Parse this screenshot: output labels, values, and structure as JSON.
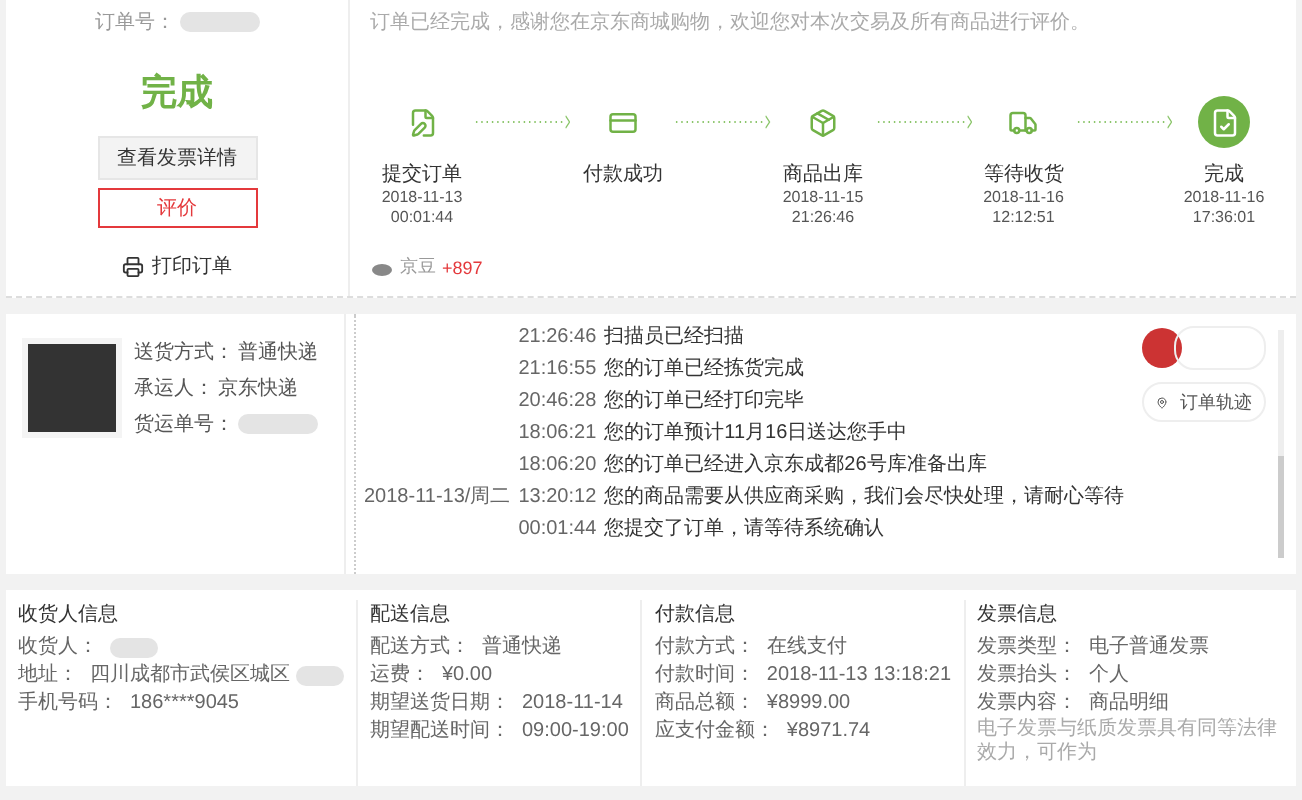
{
  "order": {
    "number_label": "订单号：",
    "status": "完成",
    "invoice_button": "查看发票详情",
    "review_button": "评价",
    "print_link": "打印订单"
  },
  "message": "订单已经完成，感谢您在京东商城购物，欢迎您对本次交易及所有商品进行评价。",
  "progress": [
    {
      "kind": "submit",
      "label": "提交订单",
      "date": "2018-11-13",
      "time": "00:01:44",
      "current": false
    },
    {
      "kind": "payment",
      "label": "付款成功",
      "current": false
    },
    {
      "kind": "outbound",
      "label": "商品出库",
      "date": "2018-11-15",
      "time": "21:26:46",
      "current": false
    },
    {
      "kind": "shipping",
      "label": "等待收货",
      "date": "2018-11-16",
      "time": "12:12:51",
      "current": false
    },
    {
      "kind": "done",
      "label": "完成",
      "date": "2018-11-16",
      "time": "17:36:01",
      "current": true
    }
  ],
  "beans": {
    "label": "京豆",
    "value": "+897"
  },
  "shipment": [
    {
      "label": "送货方式：",
      "value": "普通快递"
    },
    {
      "label": "承运人：",
      "value": "京东快递"
    },
    {
      "label": "货运单号：",
      "redacted": true
    }
  ],
  "tracking": [
    {
      "time": "21:26:46",
      "text": "扫描员已经扫描"
    },
    {
      "time": "21:16:55",
      "text": "您的订单已经拣货完成"
    },
    {
      "time": "20:46:28",
      "text": "您的订单已经打印完毕"
    },
    {
      "time": "18:06:21",
      "text": "您的订单预计11月16日送达您手中"
    },
    {
      "time": "18:06:20",
      "text": "您的订单已经进入京东成都26号库准备出库"
    },
    {
      "date": "2018-11-13/周二",
      "time": "13:20:12",
      "text": "您的商品需要从供应商采购，我们会尽快处理，请耐心等待"
    },
    {
      "time": "00:01:44",
      "text": "您提交了订单，请等待系统确认"
    }
  ],
  "track_button": "订单轨迹",
  "info_sections": [
    {
      "title": "收货人信息",
      "rows": [
        {
          "label": "收货人：",
          "redacted": true
        },
        {
          "label": "地址：",
          "value": "四川成都市武侯区城区",
          "redacted": true
        },
        {
          "label": "手机号码：",
          "value": "186****9045"
        }
      ]
    },
    {
      "title": "配送信息",
      "rows": [
        {
          "label": "配送方式：",
          "value": "普通快递"
        },
        {
          "label": "运费：",
          "value": "¥0.00"
        },
        {
          "label": "期望送货日期：",
          "value": "2018-11-14"
        },
        {
          "label": "期望配送时间：",
          "value": "09:00-19:00"
        }
      ]
    },
    {
      "title": "付款信息",
      "rows": [
        {
          "label": "付款方式：",
          "value": "在线支付"
        },
        {
          "label": "付款时间：",
          "value": "2018-11-13 13:18:21"
        },
        {
          "label": "商品总额：",
          "value": "¥8999.00"
        },
        {
          "label": "应支付金额：",
          "value": "¥8971.74"
        }
      ]
    },
    {
      "title": "发票信息",
      "rows": [
        {
          "label": "发票类型：",
          "value": "电子普通发票"
        },
        {
          "label": "发票抬头：",
          "value": "个人"
        },
        {
          "label": "发票内容：",
          "value": "商品明细"
        }
      ],
      "note": "电子发票与纸质发票具有同等法律效力，可作为"
    }
  ]
}
